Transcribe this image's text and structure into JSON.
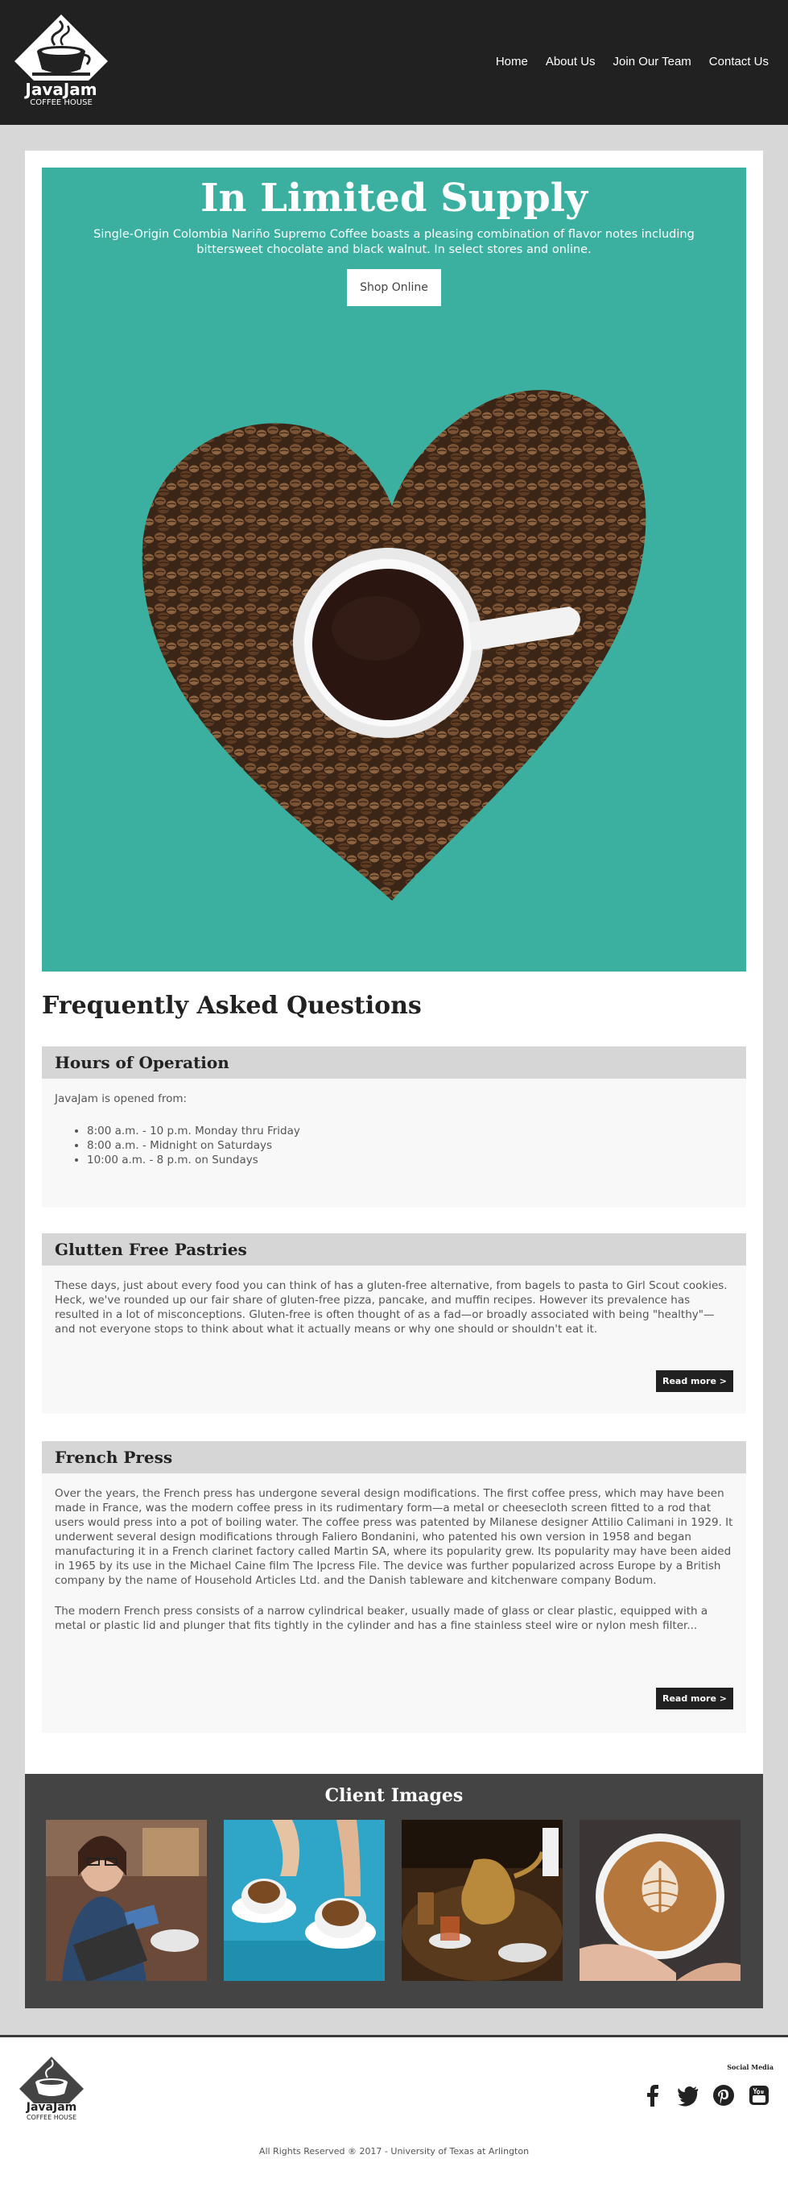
{
  "header": {
    "logo_title": "JavaJam",
    "logo_subtitle": "COFFEE HOUSE",
    "nav": [
      "Home",
      "About Us",
      "Join Our Team",
      "Contact Us"
    ]
  },
  "hero": {
    "title": "In Limited Supply",
    "text": "Single-Origin Colombia Nariño Supremo Coffee boasts a pleasing combination of flavor notes including bittersweet chocolate and black walnut. In select stores and online.",
    "button": "Shop Online"
  },
  "faq": {
    "title": "Frequently Asked Questions",
    "items": [
      {
        "question": "Hours of Operation",
        "intro": "JavaJam is opened from:",
        "hours": [
          "8:00 a.m. - 10 p.m. Monday thru Friday",
          "8:00 a.m. - Midnight on Saturdays",
          "10:00 a.m. - 8 p.m. on Sundays"
        ]
      },
      {
        "question": "Glutten Free Pastries",
        "answer": "These days, just about every food you can think of has a gluten-free alternative, from bagels to pasta to Girl Scout cookies. Heck, we've rounded up our fair share of gluten-free pizza, pancake, and muffin recipes. However its prevalence has resulted in a lot of misconceptions. Gluten-free is often thought of as a fad—or broadly associated with being \"healthy\"—and not everyone stops to think about what it actually means or why one should or shouldn't eat it.",
        "button": "Read more >"
      },
      {
        "question": "French Press",
        "answer": "Over the years, the French press has undergone several design modifications. The first coffee press, which may have been made in France, was the modern coffee press in its rudimentary form—a metal or cheesecloth screen fitted to a rod that users would press into a pot of boiling water. The coffee press was patented by Milanese designer Attilio Calimani in 1929. It underwent several design modifications through Faliero Bondanini, who patented his own version in 1958 and began manufacturing it in a French clarinet factory called Martin SA, where its popularity grew. Its popularity may have been aided in 1965 by its use in the Michael Caine film The Ipcress File. The device was further popularized across Europe by a British company by the name of Household Articles Ltd. and the Danish tableware and kitchenware company Bodum.",
        "answer2": "The modern French press consists of a narrow cylindrical beaker, usually made of glass or clear plastic, equipped with a metal or plastic lid and plunger that fits tightly in the cylinder and has a fine stainless steel wire or nylon mesh filter...",
        "button": "Read more >"
      }
    ]
  },
  "clients": {
    "title": "Client Images"
  },
  "footer": {
    "logo_title": "JavaJam",
    "logo_subtitle": "COFFEE HOUSE",
    "social_label": "Social Media",
    "social_icons": [
      "facebook-icon",
      "twitter-icon",
      "pinterest-icon",
      "youtube-icon"
    ],
    "copyright": "All Rights Reserved ® 2017 - University of Texas at Arlington"
  },
  "colors": {
    "header_bg": "#212121",
    "hero_bg": "#3bb0a1",
    "page_bg": "#d7d7d7",
    "clients_bg": "#444444"
  }
}
